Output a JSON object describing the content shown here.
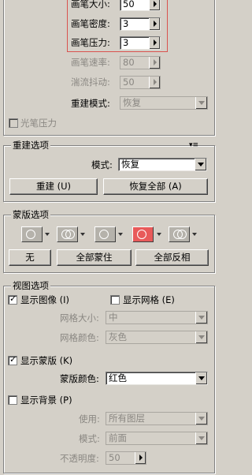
{
  "top": {
    "brush_size": {
      "label": "画笔大小:",
      "value": "50"
    },
    "brush_density": {
      "label": "画笔密度:",
      "value": "3"
    },
    "brush_pressure": {
      "label": "画笔压力:",
      "value": "3"
    },
    "brush_rate": {
      "label": "画笔速率:",
      "value": "80"
    },
    "turbulent_jitter": {
      "label": "湍流抖动:",
      "value": "50"
    },
    "reconstruct_mode": {
      "label": "重建模式:",
      "value": "恢复"
    },
    "stylus_pressure": {
      "label": "光笔压力",
      "checked": false
    }
  },
  "reconstruct": {
    "title": "重建选项",
    "mode_label": "模式:",
    "mode_value": "恢复",
    "reconstruct_btn": "重建 (U)",
    "restore_all_btn": "恢复全部 (A)"
  },
  "mask": {
    "title": "蒙版选项",
    "none_btn": "无",
    "mask_all_btn": "全部蒙住",
    "invert_all_btn": "全部反相"
  },
  "view": {
    "title": "视图选项",
    "show_image": {
      "label": "显示图像 (I)",
      "checked": true
    },
    "show_mesh": {
      "label": "显示网格 (E)",
      "checked": false
    },
    "mesh_size": {
      "label": "网格大小:",
      "value": "中"
    },
    "mesh_color": {
      "label": "网格颜色:",
      "value": "灰色"
    },
    "show_mask": {
      "label": "显示蒙版 (K)",
      "checked": true
    },
    "mask_color": {
      "label": "蒙版颜色:",
      "value": "红色"
    },
    "show_backdrop": {
      "label": "显示背景 (P)",
      "checked": false
    },
    "use": {
      "label": "使用:",
      "value": "所有图层"
    },
    "mode": {
      "label": "模式:",
      "value": "前面"
    },
    "opacity": {
      "label": "不透明度:",
      "value": "50"
    }
  },
  "colors": {
    "highlight_box": "#d9534f",
    "panel_bg": "#d4d0c8"
  }
}
